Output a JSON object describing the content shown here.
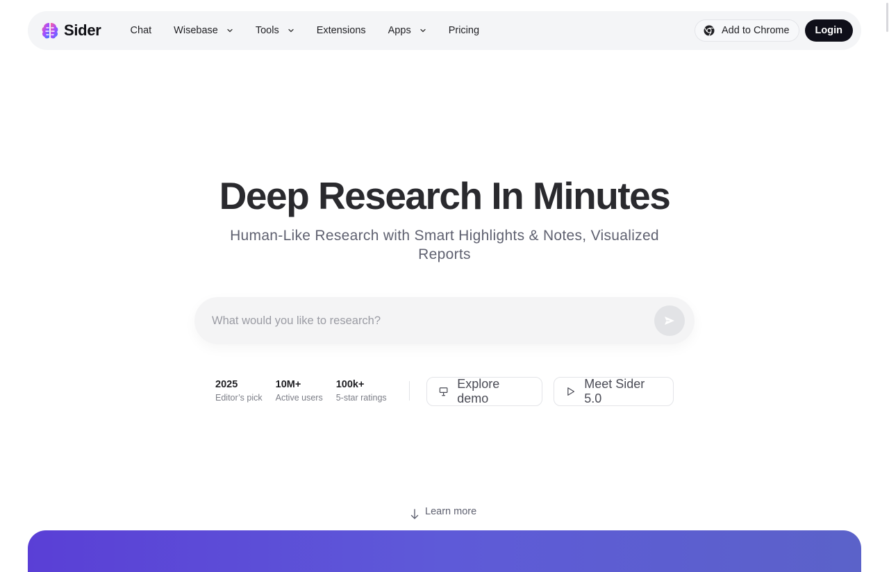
{
  "brand": {
    "name": "Sider"
  },
  "nav": {
    "items": [
      {
        "label": "Chat",
        "has_dropdown": false
      },
      {
        "label": "Wisebase",
        "has_dropdown": true
      },
      {
        "label": "Tools",
        "has_dropdown": true
      },
      {
        "label": "Extensions",
        "has_dropdown": false
      },
      {
        "label": "Apps",
        "has_dropdown": true
      },
      {
        "label": "Pricing",
        "has_dropdown": false
      }
    ],
    "add_to_chrome": "Add to Chrome",
    "login": "Login"
  },
  "hero": {
    "title": "Deep Research In Minutes",
    "subtitle": "Human-Like Research with Smart Highlights & Notes, Visualized Reports"
  },
  "search": {
    "placeholder": "What would you like to research?",
    "value": ""
  },
  "stats": [
    {
      "value": "2025",
      "label": "Editor’s pick"
    },
    {
      "value": "10M+",
      "label": "Active users"
    },
    {
      "value": "100k+",
      "label": "5-star ratings"
    }
  ],
  "actions": {
    "explore_demo": "Explore demo",
    "meet_sider": "Meet Sider 5.0"
  },
  "learn_more": "Learn more",
  "colors": {
    "accent_purple": "#5a3fd6",
    "login_bg": "#0f0f19",
    "navbar_bg": "#f4f5f7"
  },
  "icons": {
    "logo": "brain-logo-icon",
    "chrome": "chrome-icon",
    "send": "send-icon",
    "explore": "presentation-icon",
    "meet": "play-icon",
    "learn_more": "arrow-down-icon",
    "dropdown": "chevron-down-icon"
  }
}
